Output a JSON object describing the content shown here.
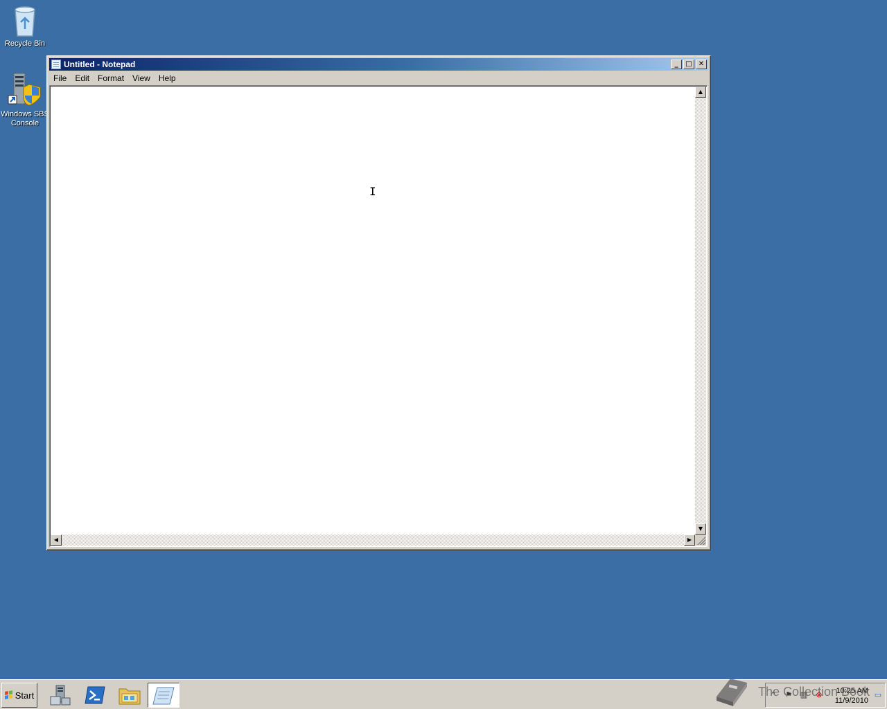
{
  "desktop": {
    "icons": [
      {
        "label": "Recycle Bin",
        "icon": "recycle-bin-icon"
      },
      {
        "label": "Windows SBS Console",
        "icon": "sbs-console-icon"
      }
    ],
    "background_color": "#3a6ea5"
  },
  "window": {
    "title": "Untitled - Notepad",
    "app_icon": "notepad-icon",
    "caption_buttons": {
      "minimize": "minimize-icon",
      "maximize": "maximize-icon",
      "close": "close-icon"
    },
    "menu": [
      "File",
      "Edit",
      "Format",
      "View",
      "Help"
    ],
    "content": ""
  },
  "taskbar": {
    "start_label": "Start",
    "pinned": [
      {
        "name": "server-manager-icon"
      },
      {
        "name": "powershell-icon"
      },
      {
        "name": "windows-explorer-icon"
      },
      {
        "name": "notepad-icon",
        "active": true
      }
    ],
    "tray": {
      "clock_time": "10:25 AM",
      "clock_date": "11/9/2010",
      "icons": [
        "show-hidden-icons-icon",
        "action-center-flag-icon",
        "network-icon",
        "volume-muted-icon",
        "show-desktop-icon"
      ]
    }
  },
  "watermark": {
    "text": "The Collection Book",
    "icon": "book-icon"
  }
}
